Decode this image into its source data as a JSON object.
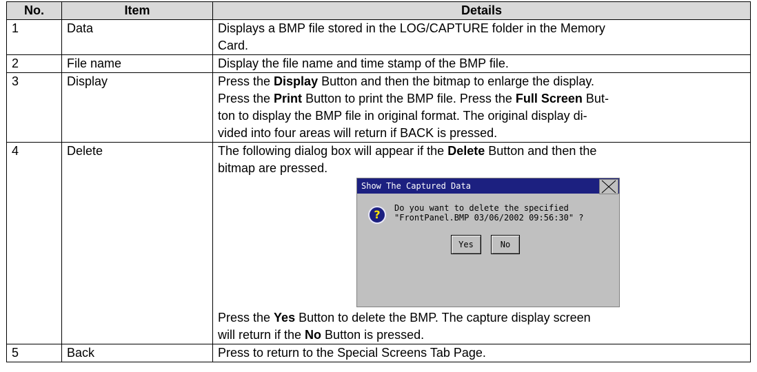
{
  "table": {
    "headers": [
      "No.",
      "Item",
      "Details"
    ],
    "rows": [
      {
        "no": "1",
        "item": "Data",
        "details": [
          "Displays a BMP file stored in the LOG/CAPTURE folder in the Memory",
          "Card."
        ]
      },
      {
        "no": "2",
        "item": "File name",
        "details": [
          "Display the file name and time stamp of the BMP file."
        ]
      },
      {
        "no": "3",
        "item": "Display",
        "line1": {
          "a": "Press the ",
          "b": "Display",
          "c": " Button and then the bitmap to enlarge the display."
        },
        "line2": {
          "a": "Press the ",
          "b": "Print",
          "c": " Button to print the BMP file. Press the ",
          "d": "Full Screen",
          "e": " But-"
        },
        "line3": "ton to display the BMP file in original format. The original display di-",
        "line4": "vided into four areas will return if BACK is pressed."
      },
      {
        "no": "4",
        "item": "Delete",
        "line1": {
          "a": "The following dialog box will appear if the ",
          "b": "Delete",
          "c": " Button and then the"
        },
        "line2": "bitmap are pressed.",
        "line3": {
          "a": "Press the ",
          "b": "Yes",
          "c": " Button to delete the BMP. The capture display screen"
        },
        "line4": {
          "a": "will return if the ",
          "b": "No",
          "c": " Button is pressed."
        }
      },
      {
        "no": "5",
        "item": "Back",
        "details": [
          "Press to return to the Special Screens Tab Page."
        ]
      }
    ]
  },
  "dialog": {
    "title": "Show The Captured Data",
    "message": "Do you want to delete the specified\n\"FrontPanel.BMP 03/06/2002 09:56:30\" ?",
    "yes_label": "Yes",
    "no_label": "No",
    "icon": "question-icon",
    "title_color": "#1c2080",
    "body_color": "#c0c0c0"
  }
}
